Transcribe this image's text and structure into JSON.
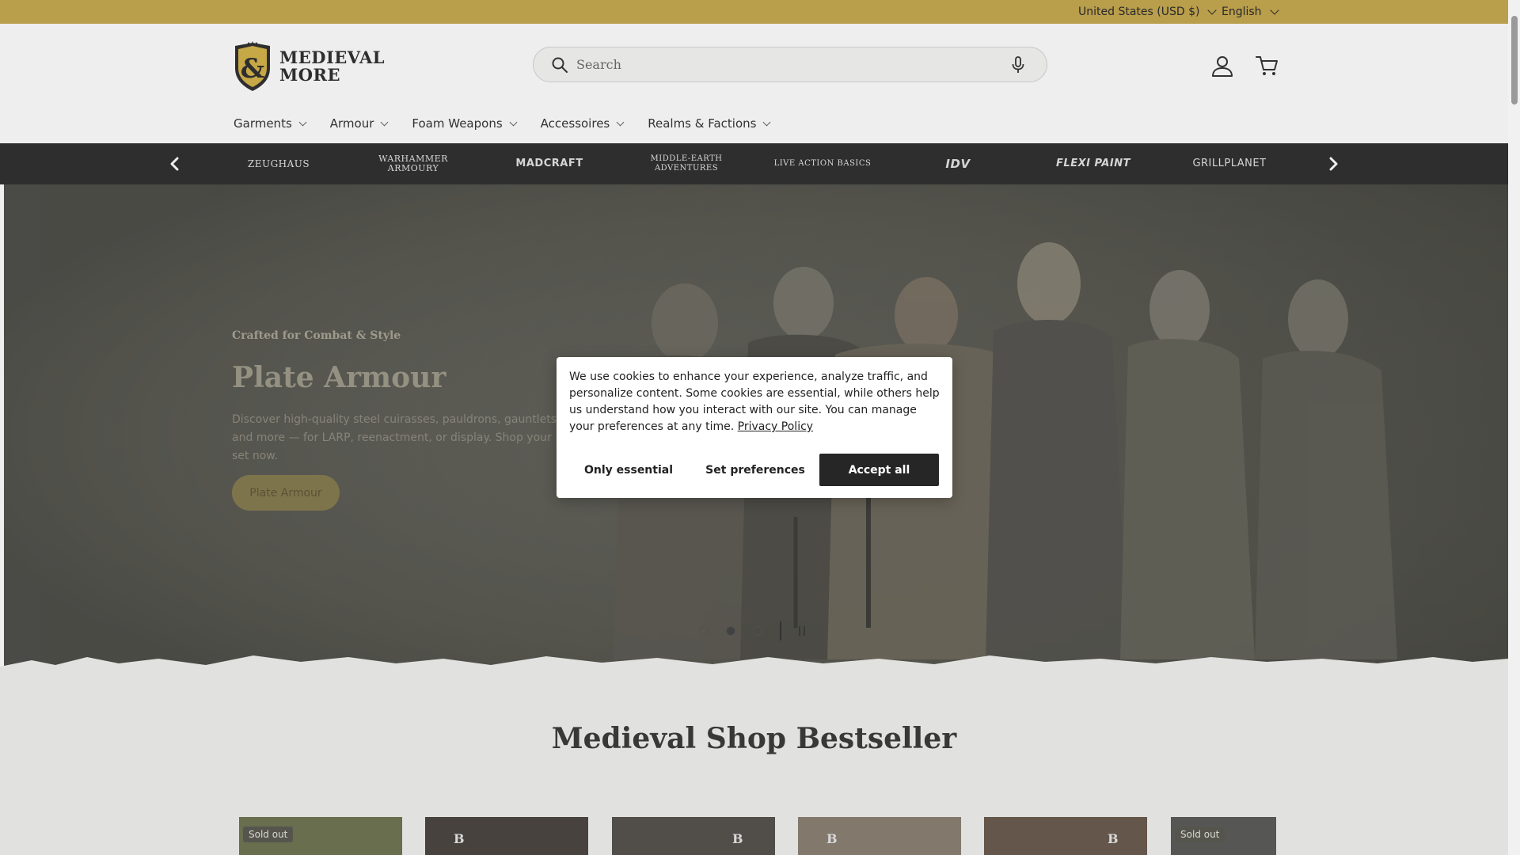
{
  "topbar": {
    "country_label": "United States (USD $)",
    "language_label": "English"
  },
  "header": {
    "logo_line1": "MEDIEVAL",
    "logo_line2": "MORE",
    "logo_mark": "&",
    "search_placeholder": "Search",
    "icons": [
      "search-icon",
      "microphone-icon",
      "account-icon",
      "cart-icon"
    ]
  },
  "nav": {
    "items": [
      "Garments",
      "Armour",
      "Foam Weapons",
      "Accessoires",
      "Realms & Factions"
    ]
  },
  "brands": {
    "items": [
      "ZEUGHAUS",
      "WARHAMMER ARMOURY",
      "MADCRAFT",
      "MIDDLE-EARTH ADVENTURES",
      "LIVE ACTION BASICS",
      "IDV",
      "FLEXI PAINT",
      "GRILLPLANET"
    ]
  },
  "hero": {
    "kicker": "Crafted for Combat & Style",
    "title": "Plate Armour",
    "description": "Discover high-quality steel cuirasses, pauldrons, gauntlets, and more — for LARP, reenactment, or display. Shop your set now.",
    "cta_label": "Plate Armour",
    "slide_count": 3,
    "active_slide": 2
  },
  "bestseller": {
    "heading": "Medieval Shop Bestseller",
    "products": [
      {
        "badge": "Sold out"
      },
      {
        "badge": ""
      },
      {
        "badge": ""
      },
      {
        "badge": ""
      },
      {
        "badge": ""
      },
      {
        "badge": "Sold out"
      }
    ]
  },
  "cookie": {
    "message": "We use cookies to enhance your experience, analyze traffic, and personalize content. Some cookies are essential, while others help us understand how you interact with our site. You can manage your preferences at any time.",
    "privacy_link": "Privacy Policy",
    "only_essential": "Only essential",
    "set_preferences": "Set preferences",
    "accept_all": "Accept all"
  },
  "colors": {
    "topbar": "#c6a950",
    "brand_strip": "#2f2f2f",
    "accept_button": "#262626"
  }
}
